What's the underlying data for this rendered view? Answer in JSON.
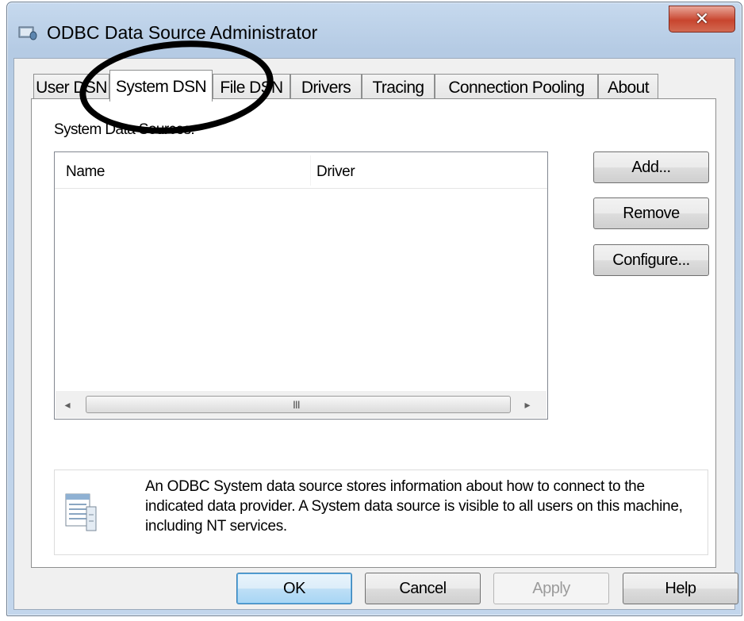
{
  "window": {
    "title": "ODBC Data Source Administrator",
    "close_glyph": "✕"
  },
  "tabs": [
    {
      "label": "User DSN",
      "active": false
    },
    {
      "label": "System DSN",
      "active": true
    },
    {
      "label": "File DSN",
      "active": false
    },
    {
      "label": "Drivers",
      "active": false
    },
    {
      "label": "Tracing",
      "active": false
    },
    {
      "label": "Connection Pooling",
      "active": false
    },
    {
      "label": "About",
      "active": false
    }
  ],
  "system_dsn": {
    "group_label": "System Data Sources:",
    "columns": [
      "Name",
      "Driver"
    ],
    "rows": [],
    "scroll_grip": "III",
    "buttons": {
      "add": "Add...",
      "remove": "Remove",
      "configure": "Configure..."
    },
    "info_text": "An ODBC System data source stores information about how to connect to the indicated data provider.   A System data source is visible to all users on this machine, including NT services."
  },
  "footer": {
    "ok": "OK",
    "cancel": "Cancel",
    "apply": "Apply",
    "help": "Help"
  },
  "icons": {
    "app": "odbc-app-icon",
    "info": "data-table-icon",
    "close": "close-icon"
  },
  "colors": {
    "title_bar": "#b5cbe4",
    "close_button": "#c8452e",
    "default_button": "#3c7fb1"
  },
  "annotation": {
    "shape": "hand-drawn ellipse",
    "highlights": "System DSN tab"
  }
}
